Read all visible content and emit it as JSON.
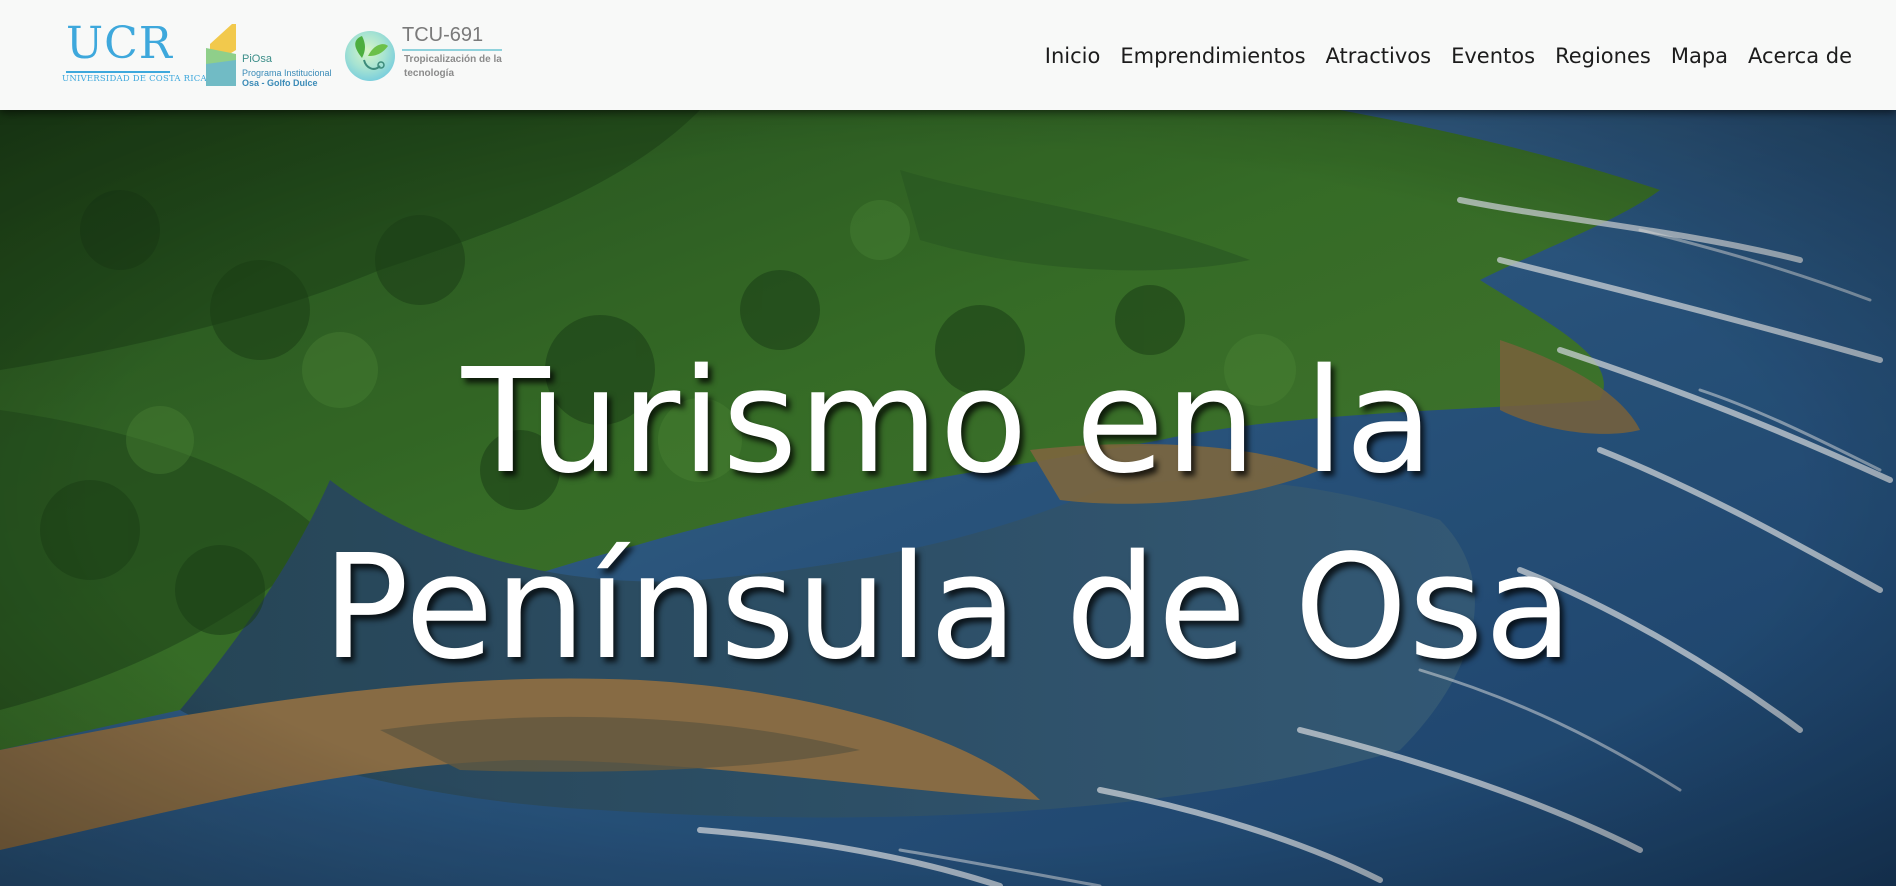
{
  "header": {
    "logos": {
      "ucr": {
        "mark": "UCR",
        "subtitle": "UNIVERSIDAD DE COSTA RICA"
      },
      "piosa": {
        "name": "PiOsa",
        "line1": "Programa Institucional",
        "line2": "Osa - Golfo Dulce"
      },
      "tcu": {
        "code": "TCU-691",
        "line1": "Tropicalización de la",
        "line2": "tecnología"
      }
    },
    "nav": [
      {
        "label": "Inicio"
      },
      {
        "label": "Emprendimientos"
      },
      {
        "label": "Atractivos"
      },
      {
        "label": "Eventos"
      },
      {
        "label": "Regiones"
      },
      {
        "label": "Mapa"
      },
      {
        "label": "Acerca de"
      }
    ]
  },
  "hero": {
    "title_line1": "Turismo en la",
    "title_line2": "Península de Osa",
    "background": "aerial-coastline-forest-photo"
  },
  "colors": {
    "header_bg": "#f8f9f8",
    "ucr_blue": "#3ea8dc",
    "forest_green": "#2f6a25",
    "ocean_blue": "#2e5f8c",
    "title_text": "#ffffff"
  }
}
